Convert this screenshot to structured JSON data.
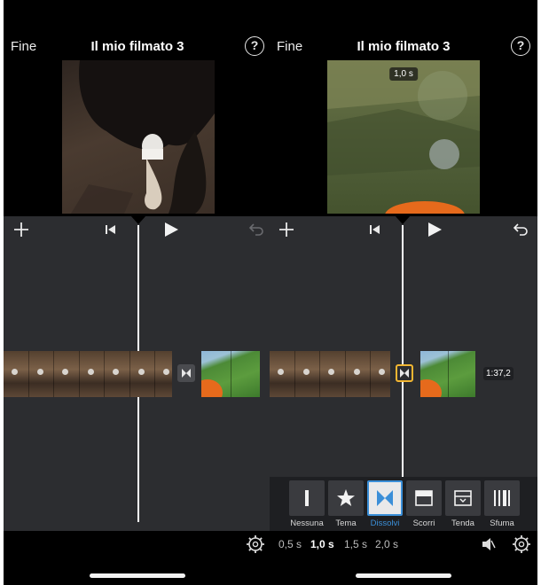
{
  "left": {
    "done_label": "Fine",
    "title": "Il mio filmato 3",
    "help_label": "?"
  },
  "right": {
    "done_label": "Fine",
    "title": "Il mio filmato 3",
    "help_label": "?",
    "preview_duration": "1,0 s",
    "clip_time": "1:37,2",
    "transitions": [
      {
        "label": "Nessuna",
        "icon": "bar-icon"
      },
      {
        "label": "Tema",
        "icon": "star-icon"
      },
      {
        "label": "Dissolvi",
        "icon": "bowtie-icon",
        "selected": true
      },
      {
        "label": "Scorri",
        "icon": "slide-icon"
      },
      {
        "label": "Tenda",
        "icon": "wipe-icon"
      },
      {
        "label": "Sfuma",
        "icon": "fade-icon"
      }
    ],
    "durations": [
      "0,5 s",
      "1,0 s",
      "1,5 s",
      "2,0 s"
    ],
    "selected_duration": "1,0 s"
  },
  "colors": {
    "editor_bg": "#2c2d30",
    "selection_accent": "#3b8fd8",
    "transition_selected_border": "#f2b632"
  }
}
